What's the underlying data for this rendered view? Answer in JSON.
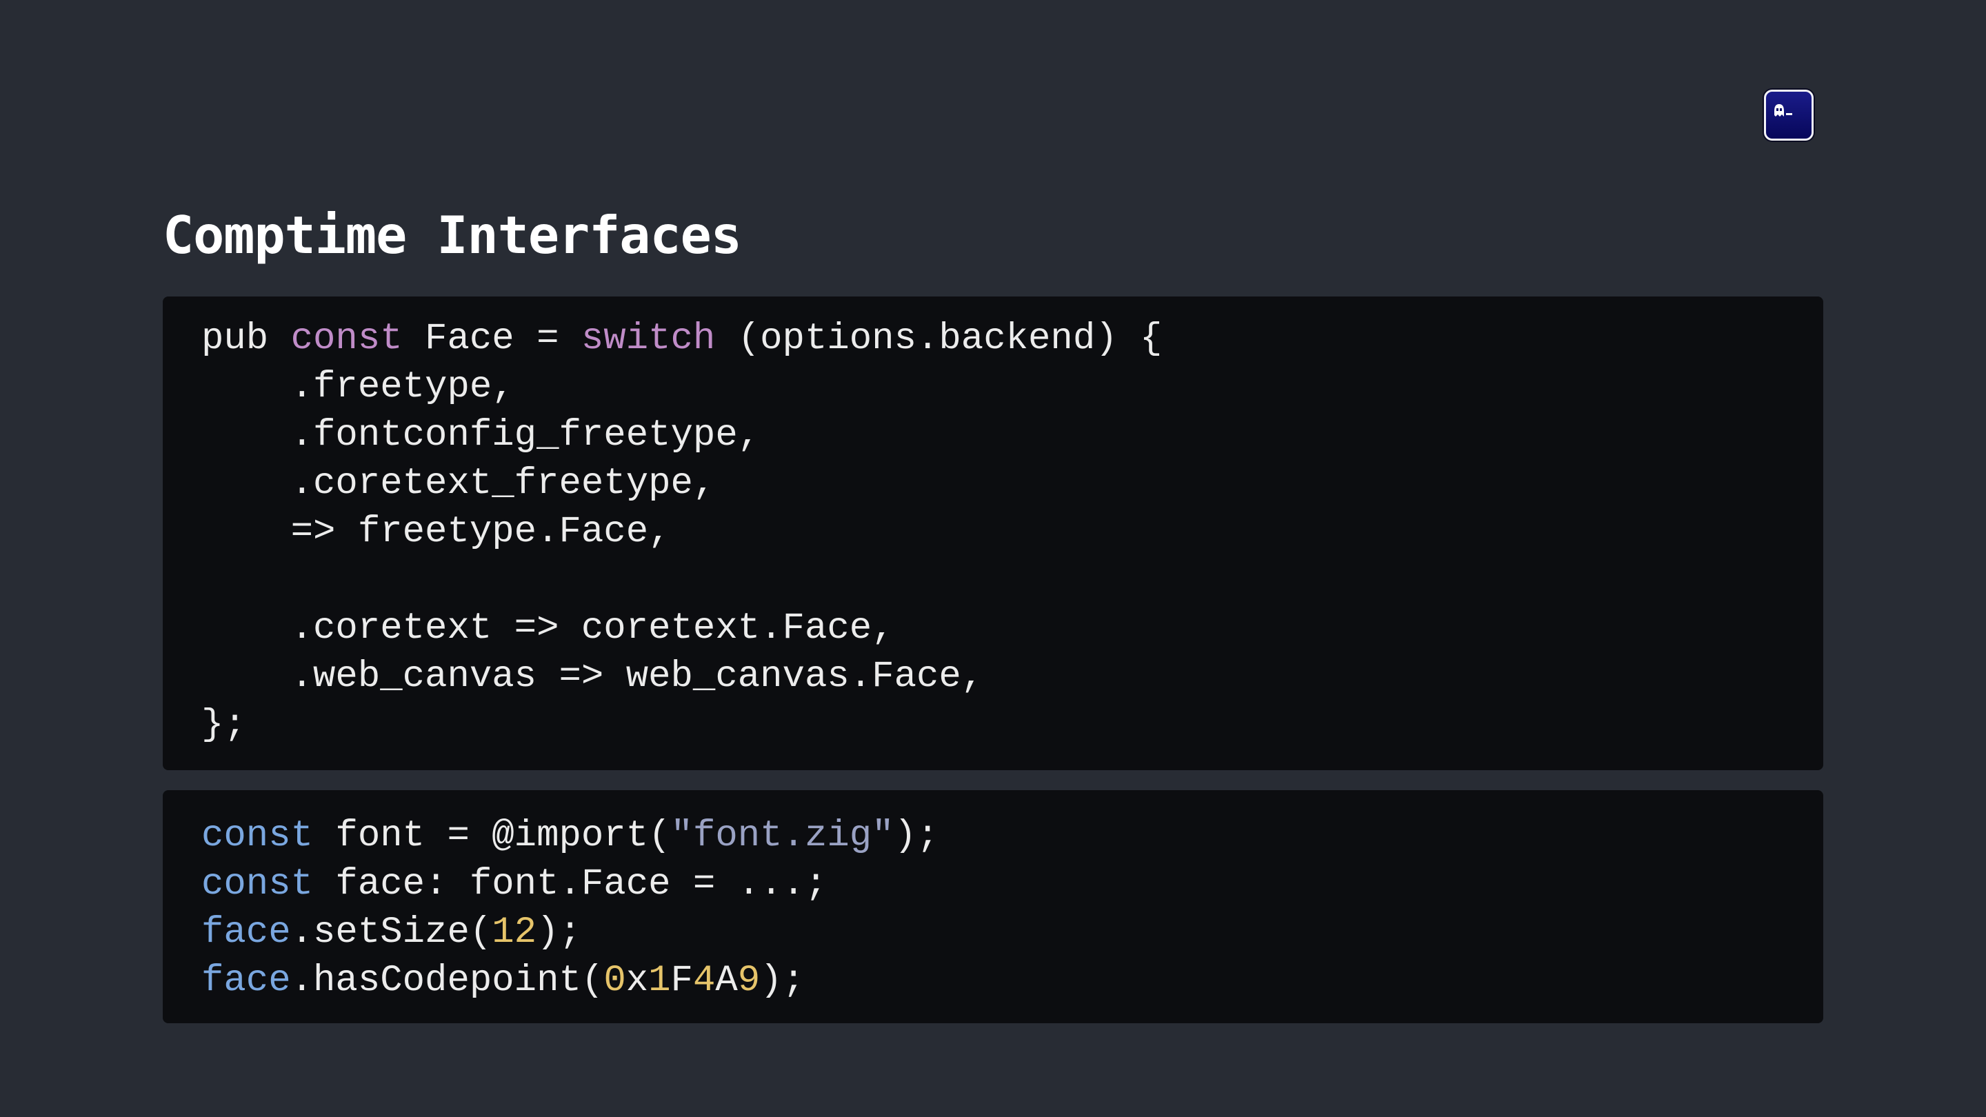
{
  "slide": {
    "title": "Comptime Interfaces",
    "logo_icon": "ghost-terminal-icon"
  },
  "colors": {
    "background": "#282c34",
    "code_background": "#0c0d10",
    "text": "#ececec",
    "keyword_purple": "#c08cc8",
    "keyword_blue": "#7aa7e0",
    "string": "#9aa2c4",
    "number": "#e6c46a"
  },
  "code_blocks": [
    {
      "lines": [
        [
          {
            "t": "pub "
          },
          {
            "t": "const",
            "c": "kw"
          },
          {
            "t": " Face = "
          },
          {
            "t": "switch",
            "c": "kw"
          },
          {
            "t": " (options.backend) {"
          }
        ],
        [
          {
            "t": "    .freetype,"
          }
        ],
        [
          {
            "t": "    .fontconfig_freetype,"
          }
        ],
        [
          {
            "t": "    .coretext_freetype,"
          }
        ],
        [
          {
            "t": "    => freetype.Face,"
          }
        ],
        [
          {
            "t": ""
          }
        ],
        [
          {
            "t": "    .coretext => coretext.Face,"
          }
        ],
        [
          {
            "t": "    .web_canvas => web_canvas.Face,"
          }
        ],
        [
          {
            "t": "};"
          }
        ]
      ]
    },
    {
      "lines": [
        [
          {
            "t": "const",
            "c": "kw2"
          },
          {
            "t": " font = @import("
          },
          {
            "t": "\"font.zig\"",
            "c": "str"
          },
          {
            "t": ");"
          }
        ],
        [
          {
            "t": "const",
            "c": "kw2"
          },
          {
            "t": " face: font.Face = ...;"
          }
        ],
        [
          {
            "t": "face",
            "c": "kw2"
          },
          {
            "t": ".setSize("
          },
          {
            "t": "12",
            "c": "num"
          },
          {
            "t": ");"
          }
        ],
        [
          {
            "t": "face",
            "c": "kw2"
          },
          {
            "t": ".hasCodepoint("
          },
          {
            "t": "0",
            "c": "num"
          },
          {
            "t": "x"
          },
          {
            "t": "1",
            "c": "num"
          },
          {
            "t": "F"
          },
          {
            "t": "4",
            "c": "num"
          },
          {
            "t": "A"
          },
          {
            "t": "9",
            "c": "num"
          },
          {
            "t": ");"
          }
        ]
      ]
    }
  ]
}
